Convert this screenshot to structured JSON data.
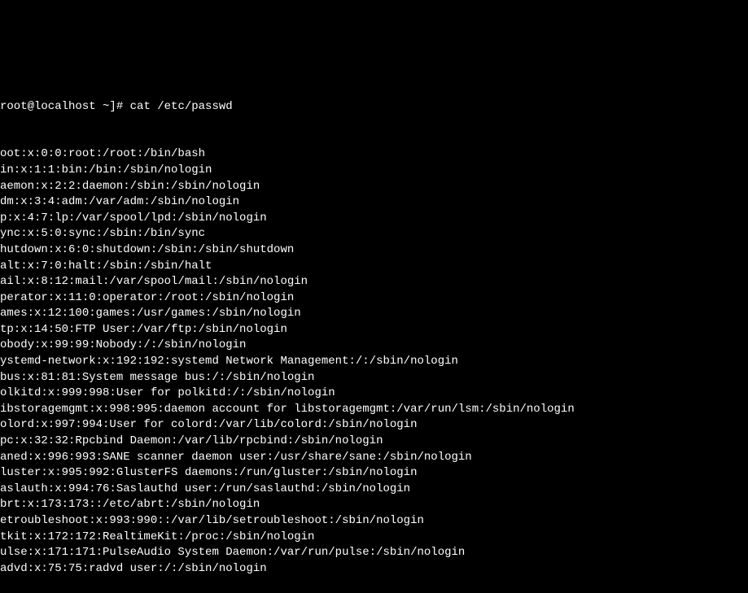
{
  "terminal": {
    "prompt": "root@localhost ~]# ",
    "command": "cat /etc/passwd",
    "lines": [
      "oot:x:0:0:root:/root:/bin/bash",
      "in:x:1:1:bin:/bin:/sbin/nologin",
      "aemon:x:2:2:daemon:/sbin:/sbin/nologin",
      "dm:x:3:4:adm:/var/adm:/sbin/nologin",
      "p:x:4:7:lp:/var/spool/lpd:/sbin/nologin",
      "ync:x:5:0:sync:/sbin:/bin/sync",
      "hutdown:x:6:0:shutdown:/sbin:/sbin/shutdown",
      "alt:x:7:0:halt:/sbin:/sbin/halt",
      "ail:x:8:12:mail:/var/spool/mail:/sbin/nologin",
      "perator:x:11:0:operator:/root:/sbin/nologin",
      "ames:x:12:100:games:/usr/games:/sbin/nologin",
      "tp:x:14:50:FTP User:/var/ftp:/sbin/nologin",
      "obody:x:99:99:Nobody:/:/sbin/nologin",
      "ystemd-network:x:192:192:systemd Network Management:/:/sbin/nologin",
      "bus:x:81:81:System message bus:/:/sbin/nologin",
      "olkitd:x:999:998:User for polkitd:/:/sbin/nologin",
      "ibstoragemgmt:x:998:995:daemon account for libstoragemgmt:/var/run/lsm:/sbin/nologin",
      "olord:x:997:994:User for colord:/var/lib/colord:/sbin/nologin",
      "pc:x:32:32:Rpcbind Daemon:/var/lib/rpcbind:/sbin/nologin",
      "aned:x:996:993:SANE scanner daemon user:/usr/share/sane:/sbin/nologin",
      "luster:x:995:992:GlusterFS daemons:/run/gluster:/sbin/nologin",
      "aslauth:x:994:76:Saslauthd user:/run/saslauthd:/sbin/nologin",
      "brt:x:173:173::/etc/abrt:/sbin/nologin",
      "etroubleshoot:x:993:990::/var/lib/setroubleshoot:/sbin/nologin",
      "tkit:x:172:172:RealtimeKit:/proc:/sbin/nologin",
      "ulse:x:171:171:PulseAudio System Daemon:/var/run/pulse:/sbin/nologin",
      "advd:x:75:75:radvd user:/:/sbin/nologin"
    ]
  }
}
